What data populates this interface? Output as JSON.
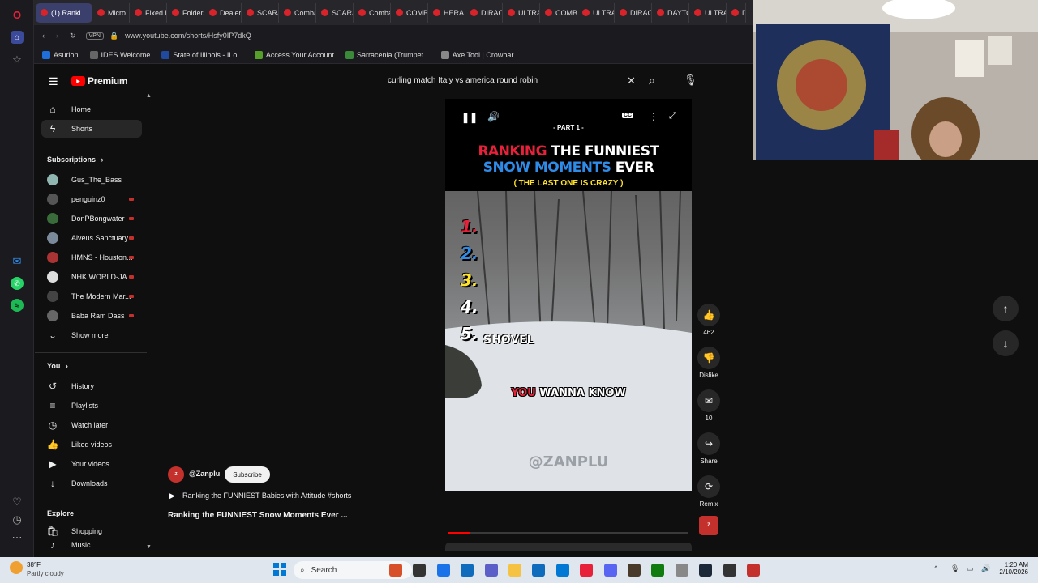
{
  "browser": {
    "tabs": [
      {
        "label": "(1) Ranki",
        "active": true
      },
      {
        "label": "Micro"
      },
      {
        "label": "Fixed B"
      },
      {
        "label": "Folders"
      },
      {
        "label": "Dealer"
      },
      {
        "label": "SCARA"
      },
      {
        "label": "Comba"
      },
      {
        "label": "SCARA"
      },
      {
        "label": "Comba"
      },
      {
        "label": "COMBA"
      },
      {
        "label": "HERA D"
      },
      {
        "label": "DIRAC"
      },
      {
        "label": "ULTRA"
      },
      {
        "label": "COMBA"
      },
      {
        "label": "ULTRA"
      },
      {
        "label": "DIRAC"
      },
      {
        "label": "DAYTO"
      },
      {
        "label": "ULTRA"
      },
      {
        "label": "Di"
      }
    ],
    "vpn_badge": "VPN",
    "url": "www.youtube.com/shorts/Hsfy0IP7dkQ",
    "bookmarks": [
      "Asurion",
      "IDES Welcome",
      "State of Illinois - ILo...",
      "Access Your Account",
      "Sarracenia (Trumpet...",
      "Axe Tool | Crowbar..."
    ]
  },
  "youtube": {
    "logo_text": "Premium",
    "search_value": "curling match Italy vs america round robin",
    "nav": [
      "Home",
      "Shorts"
    ],
    "subscriptions_heading": "Subscriptions",
    "subscriptions": [
      "Gus_The_Bass",
      "penguinz0",
      "DonPBongwater",
      "Alveus Sanctuary",
      "HMNS - Houston...",
      "NHK WORLD-JA...",
      "The Modern Mar...",
      "Baba Ram Dass"
    ],
    "show_more": "Show more",
    "you_heading": "You",
    "you_items": [
      "History",
      "Playlists",
      "Watch later",
      "Liked videos",
      "Your videos",
      "Downloads"
    ],
    "explore_heading": "Explore",
    "explore_items": [
      "Shopping",
      "Music"
    ]
  },
  "short": {
    "part_label": "- PART 1 -",
    "headline_1a": "RANKING",
    "headline_1b": "THE FUNNIEST",
    "headline_2a": "SNOW MOMENTS",
    "headline_2b": "EVER",
    "headline_3": "( THE LAST ONE IS CRAZY )",
    "ranks": [
      "1.",
      "2.",
      "3.",
      "4.",
      "5."
    ],
    "rank5_text": "SHOVEL",
    "caption_a": "YOU",
    "caption_b": "WANNA KNOW",
    "watermark": "@ZANPLU",
    "channel": "@Zanplu",
    "subscribe_label": "Subscribe",
    "related": "Ranking the FUNNIEST Babies with Attitude #shorts",
    "title": "Ranking the FUNNIEST Snow Moments Ever ...",
    "likes": "462",
    "dislike_label": "Dislike",
    "comments": "10",
    "share_label": "Share",
    "remix_label": "Remix",
    "progress": 0.09
  },
  "taskbar": {
    "weather_temp": "38°F",
    "weather_desc": "Partly cloudy",
    "search_label": "Search",
    "time": "1:20 AM",
    "date": "2/10/2026"
  },
  "colors": {
    "youtube_red": "#ff0000",
    "rank_red": "#e8213a",
    "rank_blue": "#2f8be8",
    "rank_yellow": "#ffe32b"
  }
}
